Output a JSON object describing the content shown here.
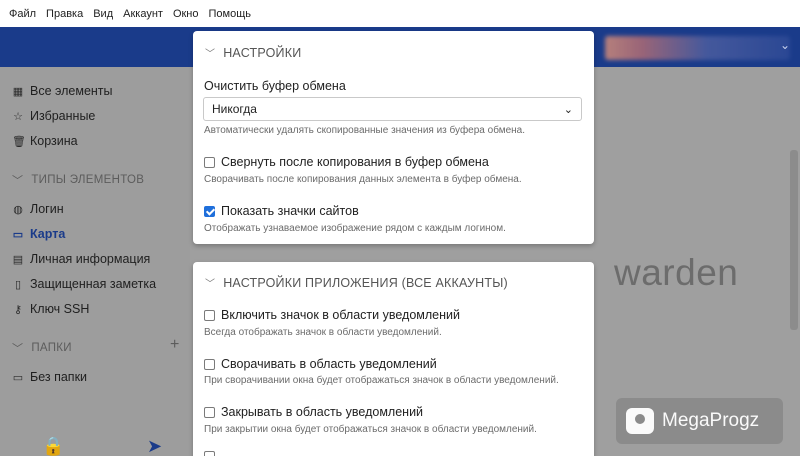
{
  "menubar": {
    "items": [
      "Файл",
      "Правка",
      "Вид",
      "Аккаунт",
      "Окно",
      "Помощь"
    ]
  },
  "sidebar": {
    "items": [
      {
        "label": "Все элементы",
        "icon": "grid-icon"
      },
      {
        "label": "Избранные",
        "icon": "star-icon"
      },
      {
        "label": "Корзина",
        "icon": "trash-icon"
      }
    ],
    "types_header": "ТИПЫ ЭЛЕМЕНТОВ",
    "types": [
      {
        "label": "Логин",
        "icon": "globe-icon"
      },
      {
        "label": "Карта",
        "icon": "credit-card-icon",
        "active": true
      },
      {
        "label": "Личная информация",
        "icon": "id-card-icon"
      },
      {
        "label": "Защищенная заметка",
        "icon": "note-icon"
      },
      {
        "label": "Ключ SSH",
        "icon": "key-icon"
      }
    ],
    "folders_header": "ПАПКИ",
    "folders": [
      {
        "label": "Без папки",
        "icon": "folder-icon"
      }
    ],
    "add_folder": "+"
  },
  "background": {
    "brand_partial": "warden"
  },
  "settings": {
    "header": "НАСТРОЙКИ",
    "clipboard_label": "Очистить буфер обмена",
    "clipboard_value": "Никогда",
    "clipboard_help": "Автоматически удалять скопированные значения из буфера обмена.",
    "minimize_label": "Свернуть после копирования в буфер обмена",
    "minimize_checked": false,
    "minimize_help": "Сворачивать после копирования данных элемента в буфер обмена.",
    "favicons_label": "Показать значки сайтов",
    "favicons_checked": true,
    "favicons_help": "Отображать узнаваемое изображение рядом с каждым логином."
  },
  "app_settings": {
    "header": "НАСТРОЙКИ ПРИЛОЖЕНИЯ (ВСЕ АККАУНТЫ)",
    "tray_label": "Включить значок в области уведомлений",
    "tray_checked": false,
    "tray_help": "Всегда отображать значок в области уведомлений.",
    "minimize_tray_label": "Сворачивать в область уведомлений",
    "minimize_tray_checked": false,
    "minimize_tray_help": "При сворачивании окна будет отображаться значок в области уведомлений.",
    "close_tray_label": "Закрывать в область уведомлений",
    "close_tray_checked": false,
    "close_tray_help": "При закрытии окна будет отображаться значок в области уведомлений."
  },
  "watermark": {
    "text": "MegaProgz"
  },
  "colors": {
    "brand": "#1a3b8a",
    "accent_checkbox": "#1f6fdb"
  }
}
